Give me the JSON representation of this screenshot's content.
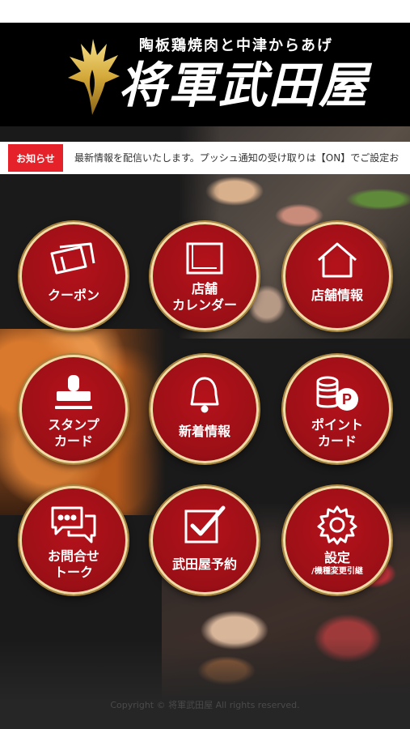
{
  "header": {
    "tagline": "陶板鶏焼肉と中津からあげ",
    "brand_name": "将軍武田屋"
  },
  "notice": {
    "tag": "お知らせ",
    "text": "最新情報を配信いたします。プッシュ通知の受け取りは【ON】でご設定お"
  },
  "menu": [
    {
      "label": "クーポン",
      "icon": "coupon-icon"
    },
    {
      "label": "店舗\nカレンダー",
      "icon": "calendar-icon"
    },
    {
      "label": "店舗情報",
      "icon": "store-icon"
    },
    {
      "label": "スタンプ\nカード",
      "icon": "stamp-icon"
    },
    {
      "label": "新着情報",
      "icon": "bell-icon"
    },
    {
      "label": "ポイント\nカード",
      "icon": "points-icon"
    },
    {
      "label": "お問合せ\nトーク",
      "icon": "chat-icon"
    },
    {
      "label": "武田屋予約",
      "icon": "checkbox-icon"
    },
    {
      "label": "設定",
      "sublabel": "/機種変更引継",
      "icon": "gear-icon"
    }
  ],
  "footer": {
    "copyright": "Copyright © 将軍武田屋 All rights reserved."
  },
  "colors": {
    "button_red": "#a8111a",
    "button_border": "#f2dca6",
    "notice_red": "#e5222a",
    "logo_gold": "#d4a93a"
  }
}
